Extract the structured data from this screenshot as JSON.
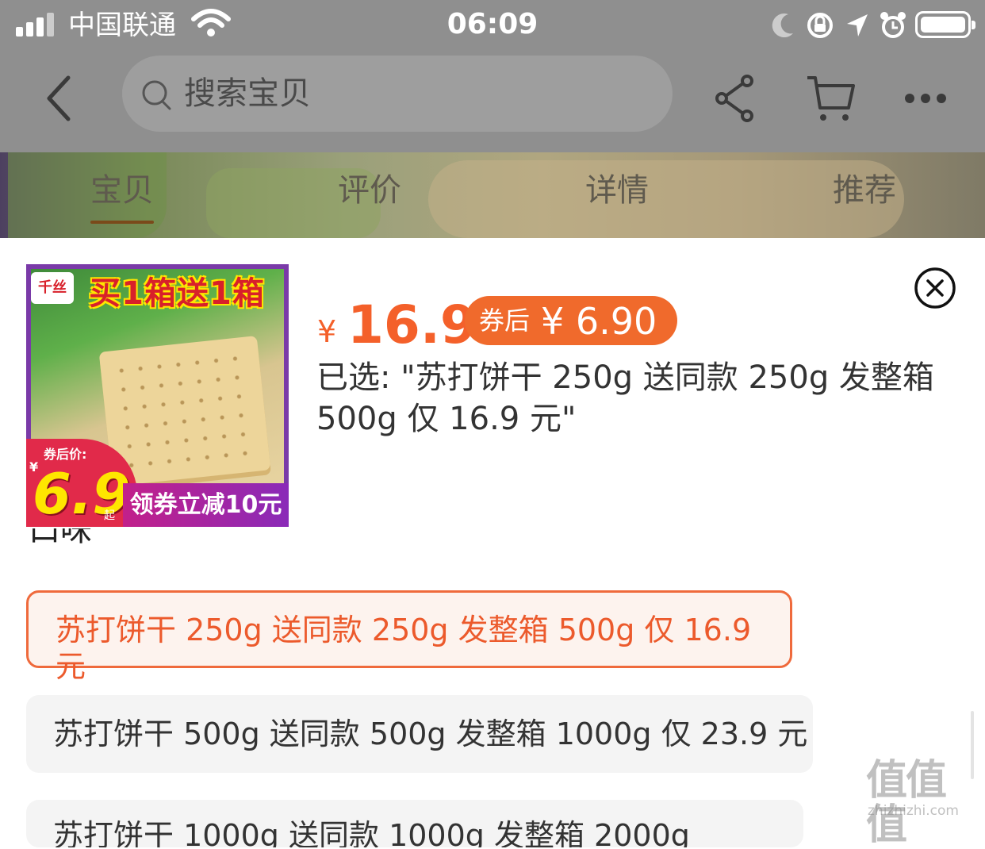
{
  "status_bar": {
    "carrier": "中国联通",
    "time": "06:09"
  },
  "nav": {
    "search_placeholder": "搜索宝贝"
  },
  "tabs": [
    {
      "label": "宝贝",
      "active": true
    },
    {
      "label": "评价",
      "active": false
    },
    {
      "label": "详情",
      "active": false
    },
    {
      "label": "推荐",
      "active": false
    }
  ],
  "product": {
    "image": {
      "banner_text": "买1箱送1箱",
      "logo_text": "千丝",
      "price_label": "券后价:",
      "price_yen": "¥",
      "price_value": "6.9",
      "price_suffix": "起",
      "coupon_text": "领券立减10元"
    },
    "price_currency": "¥",
    "price": "16.9",
    "coupon_label": "券后",
    "coupon_price": "¥ 6.90",
    "selected_text": "已选: \"苏打饼干 250g 送同款 250g 发整箱 500g 仅 16.9 元\""
  },
  "sku": {
    "section_label": "口味",
    "options": [
      {
        "label": "苏打饼干 250g 送同款 250g 发整箱 500g 仅 16.9 元",
        "selected": true
      },
      {
        "label": "苏打饼干 500g 送同款 500g 发整箱 1000g 仅 23.9 元",
        "selected": false
      },
      {
        "label": "苏打饼干 1000g 送同款 1000g 发整箱 2000g",
        "selected": false
      }
    ]
  },
  "watermark": {
    "logo_text": "值值值",
    "site": "zhizhizhi.com"
  },
  "colors": {
    "accent": "#f4602a",
    "coupon_bg": "#f06a2c",
    "selected_border": "#ef6a3c",
    "overlay": "#8f8f8f"
  },
  "icons": [
    "signal-icon",
    "wifi-icon",
    "moon-icon",
    "rotation-lock-icon",
    "location-icon",
    "alarm-icon",
    "battery-icon",
    "back-icon",
    "search-icon",
    "share-icon",
    "cart-icon",
    "more-icon",
    "close-icon"
  ]
}
